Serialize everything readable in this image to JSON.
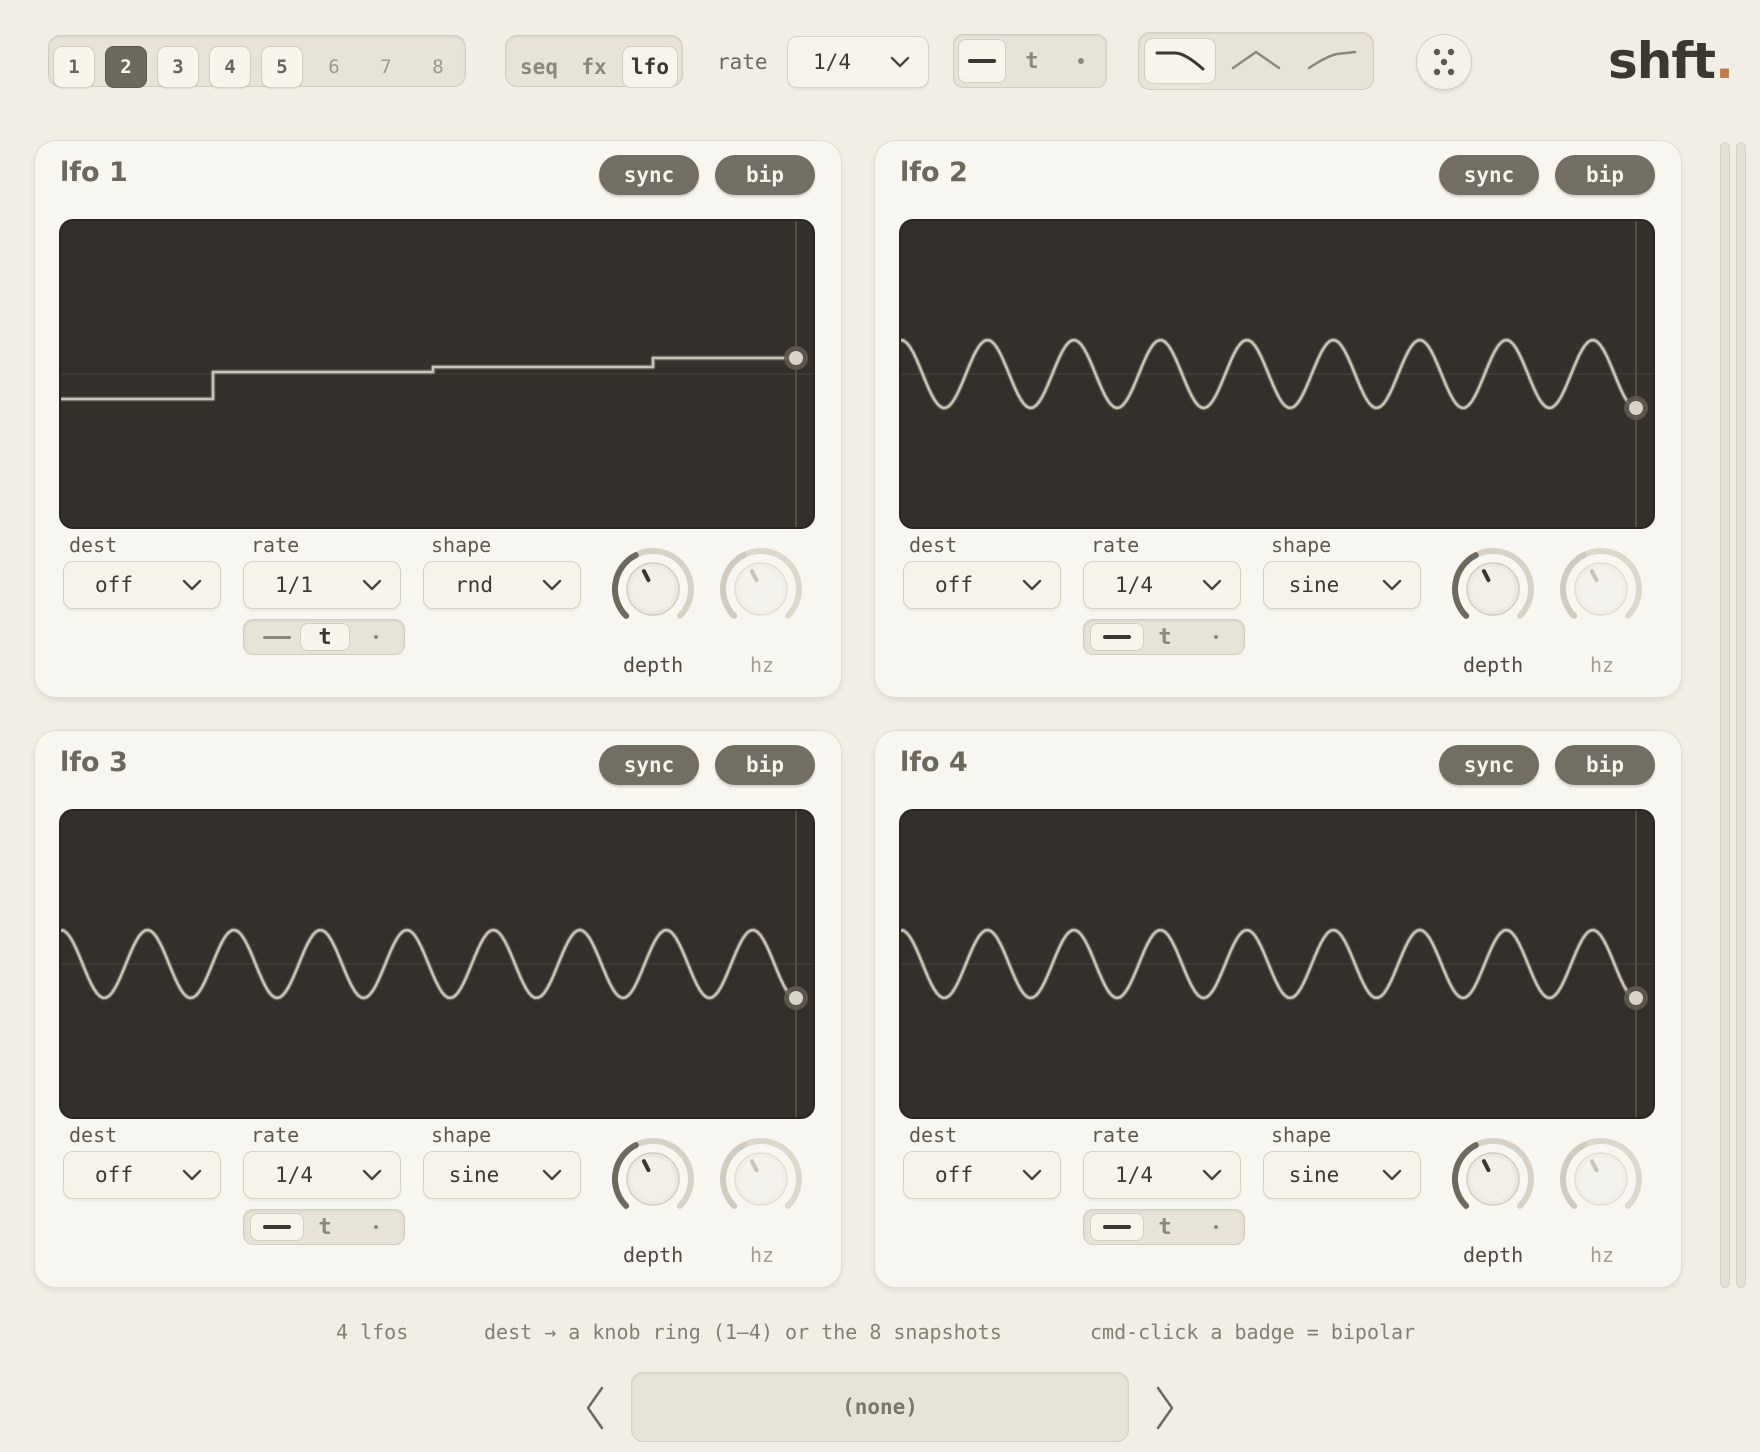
{
  "snapshots": {
    "items": [
      "1",
      "2",
      "3",
      "4",
      "5",
      "6",
      "7",
      "8"
    ],
    "active_index": 1,
    "filled": [
      true,
      true,
      true,
      true,
      true,
      false,
      false,
      false
    ]
  },
  "modes": {
    "items": [
      "seq",
      "fx",
      "lfo"
    ],
    "active": "lfo"
  },
  "global_rate": {
    "label": "rate",
    "value": "1/4"
  },
  "global_trigger": {
    "items": [
      "dash",
      "t",
      "dot"
    ],
    "active": "dash"
  },
  "curve_shapes": {
    "items": [
      "fall-curve",
      "peak-curve",
      "rise-curve"
    ],
    "active": "fall-curve"
  },
  "dots_button_icon": "dots-icon",
  "logo": {
    "text": "shft",
    "dot": ".",
    "dot_color": "#c07a4a"
  },
  "lfos": [
    {
      "title": "lfo 1",
      "sync": "sync",
      "bip": "bip",
      "dest_label": "dest",
      "dest": "off",
      "rate_label": "rate",
      "rate": "1/1",
      "shape_label": "shape",
      "shape": "rnd",
      "trigger_active": "t",
      "depth_label": "depth",
      "hz_label": "hz",
      "depth_level": 0.4,
      "hz_level": 0.4
    },
    {
      "title": "lfo 2",
      "sync": "sync",
      "bip": "bip",
      "dest_label": "dest",
      "dest": "off",
      "rate_label": "rate",
      "rate": "1/4",
      "shape_label": "shape",
      "shape": "sine",
      "trigger_active": "dash",
      "depth_label": "depth",
      "hz_label": "hz",
      "depth_level": 0.4,
      "hz_level": 0.4
    },
    {
      "title": "lfo 3",
      "sync": "sync",
      "bip": "bip",
      "dest_label": "dest",
      "dest": "off",
      "rate_label": "rate",
      "rate": "1/4",
      "shape_label": "shape",
      "shape": "sine",
      "trigger_active": "dash",
      "depth_label": "depth",
      "hz_label": "hz",
      "depth_level": 0.4,
      "hz_level": 0.4
    },
    {
      "title": "lfo 4",
      "sync": "sync",
      "bip": "bip",
      "dest_label": "dest",
      "dest": "off",
      "rate_label": "rate",
      "rate": "1/4",
      "shape_label": "shape",
      "shape": "sine",
      "trigger_active": "dash",
      "depth_label": "depth",
      "hz_label": "hz",
      "depth_level": 0.4,
      "hz_level": 0.4
    }
  ],
  "hints": {
    "a": "4 lfos",
    "b": "dest → a knob ring (1–4) or the 8 snapshots",
    "c": "cmd-click a badge = bipolar"
  },
  "preset": {
    "value": "(none)"
  },
  "colors": {
    "accent": "#6e695f",
    "scope_bg": "#33302b",
    "wave": "#bdb8ad"
  }
}
